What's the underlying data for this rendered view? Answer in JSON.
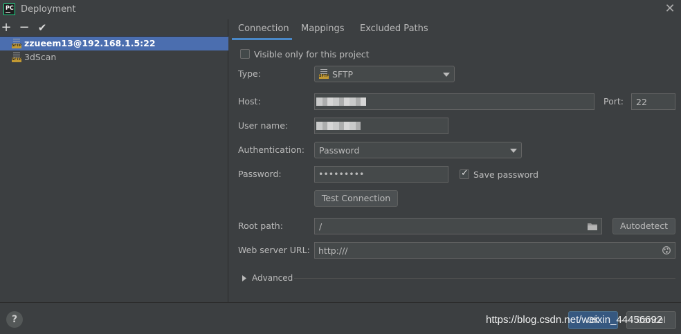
{
  "window": {
    "title": "Deployment",
    "close_glyph": "✕",
    "logo_text": "PC"
  },
  "toolbar": {
    "add": "+",
    "remove": "−",
    "apply": "✔"
  },
  "servers": [
    {
      "name": "zzueem13@192.168.1.5:22",
      "icon": "sftp-icon",
      "tag": "SFTP",
      "selected": true
    },
    {
      "name": "3dScan",
      "icon": "sftp-icon",
      "tag": "SFTP",
      "selected": false
    }
  ],
  "tabs": [
    {
      "label": "Connection",
      "active": true
    },
    {
      "label": "Mappings",
      "active": false
    },
    {
      "label": "Excluded Paths",
      "active": false
    }
  ],
  "form": {
    "visible_only": {
      "label": "Visible only for this project",
      "checked": false
    },
    "type": {
      "label": "Type:",
      "value": "SFTP",
      "tag": "SFTP"
    },
    "host": {
      "label": "Host:",
      "value": ""
    },
    "port": {
      "label": "Port:",
      "value": "22"
    },
    "username": {
      "label": "User name:",
      "value": ""
    },
    "authentication": {
      "label": "Authentication:",
      "value": "Password"
    },
    "password": {
      "label": "Password:",
      "value": "•••••••••"
    },
    "save_password": {
      "label": "Save password",
      "checked": true
    },
    "test_connection": "Test Connection",
    "root_path": {
      "label": "Root path:",
      "value": "/"
    },
    "autodetect": "Autodetect",
    "web_server_url": {
      "label": "Web server URL:",
      "value": "http:///"
    },
    "advanced": "Advanced"
  },
  "footer": {
    "help": "?",
    "ok": "OK",
    "cancel": "Cancel"
  },
  "watermark": "https://blog.csdn.net/weixin_44456692",
  "colors": {
    "accent": "#4b6eaf",
    "tab_underline": "#4a88c7",
    "ok_button": "#365880",
    "background": "#3c3f41"
  }
}
